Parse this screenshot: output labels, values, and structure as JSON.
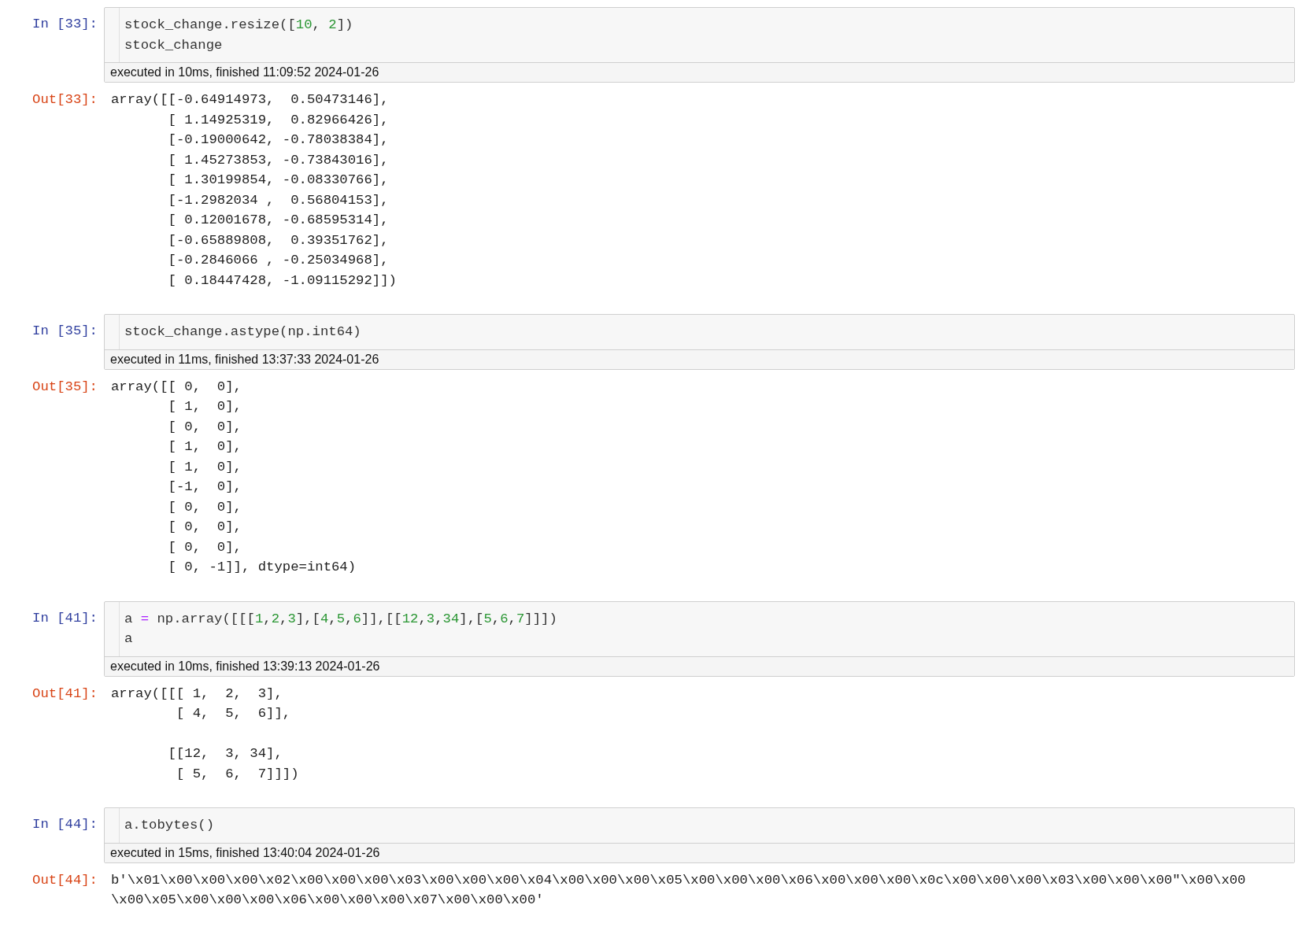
{
  "cells": [
    {
      "in_prompt": "In [33]:",
      "code": [
        [
          {
            "kind": "plain",
            "text": "stock_change.resize(["
          },
          {
            "kind": "number",
            "text": "10"
          },
          {
            "kind": "plain",
            "text": ", "
          },
          {
            "kind": "number",
            "text": "2"
          },
          {
            "kind": "plain",
            "text": "])"
          }
        ],
        [
          {
            "kind": "plain",
            "text": "stock_change"
          }
        ]
      ],
      "execution": "executed in 10ms, finished 11:09:52 2024-01-26",
      "out_prompt": "Out[33]:",
      "output": [
        "array([[-0.64914973,  0.50473146],",
        "       [ 1.14925319,  0.82966426],",
        "       [-0.19000642, -0.78038384],",
        "       [ 1.45273853, -0.73843016],",
        "       [ 1.30199854, -0.08330766],",
        "       [-1.2982034 ,  0.56804153],",
        "       [ 0.12001678, -0.68595314],",
        "       [-0.65889808,  0.39351762],",
        "       [-0.2846066 , -0.25034968],",
        "       [ 0.18447428, -1.09115292]])"
      ]
    },
    {
      "in_prompt": "In [35]:",
      "code": [
        [
          {
            "kind": "plain",
            "text": "stock_change.astype(np.int64)"
          }
        ]
      ],
      "execution": "executed in 11ms, finished 13:37:33 2024-01-26",
      "out_prompt": "Out[35]:",
      "output": [
        "array([[ 0,  0],",
        "       [ 1,  0],",
        "       [ 0,  0],",
        "       [ 1,  0],",
        "       [ 1,  0],",
        "       [-1,  0],",
        "       [ 0,  0],",
        "       [ 0,  0],",
        "       [ 0,  0],",
        "       [ 0, -1]], dtype=int64)"
      ]
    },
    {
      "in_prompt": "In [41]:",
      "code": [
        [
          {
            "kind": "plain",
            "text": "a "
          },
          {
            "kind": "operator",
            "text": "="
          },
          {
            "kind": "plain",
            "text": " np.array([[["
          },
          {
            "kind": "number",
            "text": "1"
          },
          {
            "kind": "plain",
            "text": ","
          },
          {
            "kind": "number",
            "text": "2"
          },
          {
            "kind": "plain",
            "text": ","
          },
          {
            "kind": "number",
            "text": "3"
          },
          {
            "kind": "plain",
            "text": "],["
          },
          {
            "kind": "number",
            "text": "4"
          },
          {
            "kind": "plain",
            "text": ","
          },
          {
            "kind": "number",
            "text": "5"
          },
          {
            "kind": "plain",
            "text": ","
          },
          {
            "kind": "number",
            "text": "6"
          },
          {
            "kind": "plain",
            "text": "]],[["
          },
          {
            "kind": "number",
            "text": "12"
          },
          {
            "kind": "plain",
            "text": ","
          },
          {
            "kind": "number",
            "text": "3"
          },
          {
            "kind": "plain",
            "text": ","
          },
          {
            "kind": "number",
            "text": "34"
          },
          {
            "kind": "plain",
            "text": "],["
          },
          {
            "kind": "number",
            "text": "5"
          },
          {
            "kind": "plain",
            "text": ","
          },
          {
            "kind": "number",
            "text": "6"
          },
          {
            "kind": "plain",
            "text": ","
          },
          {
            "kind": "number",
            "text": "7"
          },
          {
            "kind": "plain",
            "text": "]]])"
          }
        ],
        [
          {
            "kind": "plain",
            "text": "a"
          }
        ]
      ],
      "execution": "executed in 10ms, finished 13:39:13 2024-01-26",
      "out_prompt": "Out[41]:",
      "output": [
        "array([[[ 1,  2,  3],",
        "        [ 4,  5,  6]],"
      ],
      "output_continued": [
        "       [[12,  3, 34],",
        "        [ 5,  6,  7]]])"
      ]
    },
    {
      "in_prompt": "In [44]:",
      "code": [
        [
          {
            "kind": "plain",
            "text": "a.tobytes()"
          }
        ]
      ],
      "execution": "executed in 15ms, finished 13:40:04 2024-01-26",
      "out_prompt": "Out[44]:",
      "output": [
        "b'\\x01\\x00\\x00\\x00\\x02\\x00\\x00\\x00\\x03\\x00\\x00\\x00\\x04\\x00\\x00\\x00\\x05\\x00\\x00\\x00\\x06\\x00\\x00\\x00\\x0c\\x00\\x00\\x00\\x03\\x00\\x00\\x00\"\\x00\\x00",
        "\\x00\\x05\\x00\\x00\\x00\\x06\\x00\\x00\\x00\\x07\\x00\\x00\\x00'"
      ]
    }
  ]
}
